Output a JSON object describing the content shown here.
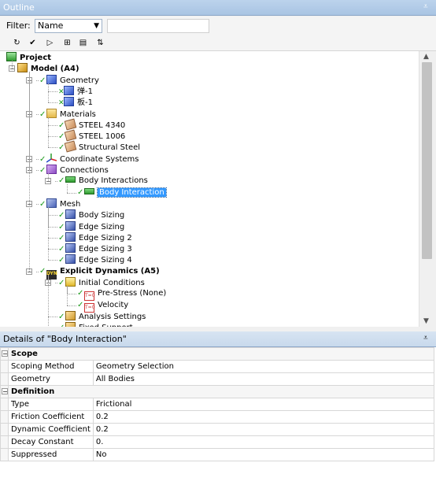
{
  "outline": {
    "title": "Outline",
    "pin_glyph": "⩡",
    "filter": {
      "label": "Filter:",
      "value": "Name",
      "search_value": ""
    },
    "toolbar": [
      {
        "name": "refresh-icon",
        "glyph": "↻"
      },
      {
        "name": "tree-filter-icon",
        "glyph": "✔"
      },
      {
        "name": "generate-icon",
        "glyph": "▷"
      },
      {
        "name": "expand-all-icon",
        "glyph": "⊞"
      },
      {
        "name": "folder-icon",
        "glyph": "▤"
      },
      {
        "name": "sort-icon",
        "glyph": "⇅"
      }
    ],
    "tree": [
      {
        "label": "Project",
        "bold": true,
        "icon": "project",
        "icon_name": "project-icon"
      },
      {
        "label": "Model (A4)",
        "bold": true,
        "icon": "model",
        "icon_name": "model-icon"
      },
      {
        "label": "Geometry",
        "icon": "cube",
        "icon_name": "geometry-icon"
      },
      {
        "label": "弹-1",
        "icon": "cube",
        "icon_name": "part-icon"
      },
      {
        "label": "板-1",
        "icon": "cube",
        "icon_name": "part-icon"
      },
      {
        "label": "Materials",
        "icon": "folder",
        "icon_name": "materials-folder-icon"
      },
      {
        "label": "STEEL 4340",
        "icon": "mat",
        "icon_name": "material-icon"
      },
      {
        "label": "STEEL 1006",
        "icon": "mat",
        "icon_name": "material-icon"
      },
      {
        "label": "Structural Steel",
        "icon": "mat",
        "icon_name": "material-icon"
      },
      {
        "label": "Coordinate Systems",
        "icon": "coord",
        "icon_name": "coordinate-systems-icon"
      },
      {
        "label": "Connections",
        "icon": "conn",
        "icon_name": "connections-icon"
      },
      {
        "label": "Body Interactions",
        "icon": "bi",
        "icon_name": "body-interactions-icon"
      },
      {
        "label": "Body Interaction",
        "icon": "bi",
        "icon_name": "body-interaction-icon",
        "selected": true
      },
      {
        "label": "Mesh",
        "icon": "mesh",
        "icon_name": "mesh-icon"
      },
      {
        "label": "Body Sizing",
        "icon": "sizing",
        "icon_name": "sizing-icon"
      },
      {
        "label": "Edge Sizing",
        "icon": "sizing",
        "icon_name": "sizing-icon"
      },
      {
        "label": "Edge Sizing 2",
        "icon": "sizing",
        "icon_name": "sizing-icon"
      },
      {
        "label": "Edge Sizing 3",
        "icon": "sizing",
        "icon_name": "sizing-icon"
      },
      {
        "label": "Edge Sizing 4",
        "icon": "sizing",
        "icon_name": "sizing-icon"
      },
      {
        "label": "Explicit Dynamics (A5)",
        "bold": true,
        "icon": "dyn",
        "icon_name": "explicit-dynamics-icon",
        "icon_text": "DYN"
      },
      {
        "label": "Initial Conditions",
        "icon": "init",
        "icon_name": "initial-conditions-icon"
      },
      {
        "label": "Pre-Stress (None)",
        "icon": "tvs",
        "icon_name": "prestress-icon",
        "icon_text": "T=0"
      },
      {
        "label": "Velocity",
        "icon": "tvs",
        "icon_name": "velocity-icon",
        "icon_text": "T=0"
      },
      {
        "label": "Analysis Settings",
        "icon": "analysis",
        "icon_name": "analysis-settings-icon"
      },
      {
        "label": "Fixed Support",
        "icon": "analysis",
        "icon_name": "fixed-support-icon"
      }
    ]
  },
  "details": {
    "title": "Details of \"Body Interaction\"",
    "pin_glyph": "⩡",
    "sections": [
      {
        "name": "Scope",
        "rows": [
          {
            "name": "Scoping Method",
            "value": "Geometry Selection"
          },
          {
            "name": "Geometry",
            "value": "All Bodies"
          }
        ]
      },
      {
        "name": "Definition",
        "rows": [
          {
            "name": "Type",
            "value": "Frictional"
          },
          {
            "name": "Friction Coefficient",
            "value": "0.2"
          },
          {
            "name": "Dynamic Coefficient",
            "value": "0.2"
          },
          {
            "name": "Decay Constant",
            "value": "0."
          },
          {
            "name": "Suppressed",
            "value": "No"
          }
        ]
      }
    ]
  }
}
